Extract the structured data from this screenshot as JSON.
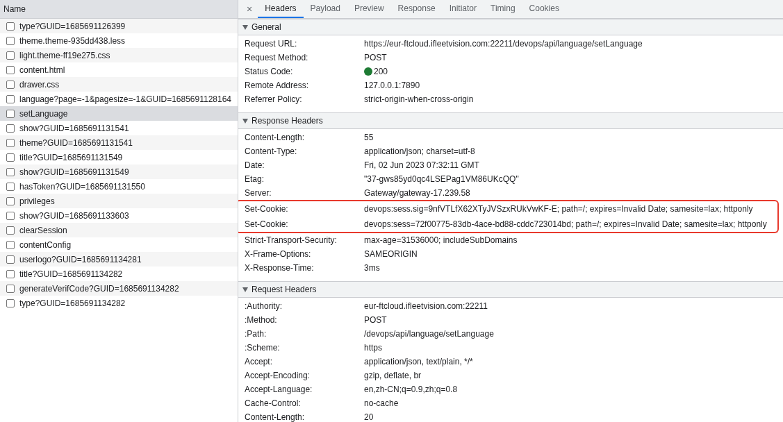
{
  "request_list": {
    "column": "Name",
    "rows": [
      {
        "name": "type?GUID=1685691126399",
        "selected": false
      },
      {
        "name": "theme.theme-935dd438.less",
        "selected": false
      },
      {
        "name": "light.theme-ff19e275.css",
        "selected": false
      },
      {
        "name": "content.html",
        "selected": false
      },
      {
        "name": "drawer.css",
        "selected": false
      },
      {
        "name": "language?page=-1&pagesize=-1&GUID=1685691128164",
        "selected": false
      },
      {
        "name": "setLanguage",
        "selected": true
      },
      {
        "name": "show?GUID=1685691131541",
        "selected": false
      },
      {
        "name": "theme?GUID=1685691131541",
        "selected": false
      },
      {
        "name": "title?GUID=1685691131549",
        "selected": false
      },
      {
        "name": "show?GUID=1685691131549",
        "selected": false
      },
      {
        "name": "hasToken?GUID=1685691131550",
        "selected": false
      },
      {
        "name": "privileges",
        "selected": false
      },
      {
        "name": "show?GUID=1685691133603",
        "selected": false
      },
      {
        "name": "clearSession",
        "selected": false
      },
      {
        "name": "contentConfig",
        "selected": false
      },
      {
        "name": "userlogo?GUID=1685691134281",
        "selected": false
      },
      {
        "name": "title?GUID=1685691134282",
        "selected": false
      },
      {
        "name": "generateVerifCode?GUID=1685691134282",
        "selected": false
      },
      {
        "name": "type?GUID=1685691134282",
        "selected": false
      }
    ]
  },
  "close_button": "×",
  "tabs": [
    {
      "label": "Headers",
      "selected": true
    },
    {
      "label": "Payload",
      "selected": false
    },
    {
      "label": "Preview",
      "selected": false
    },
    {
      "label": "Response",
      "selected": false
    },
    {
      "label": "Initiator",
      "selected": false
    },
    {
      "label": "Timing",
      "selected": false
    },
    {
      "label": "Cookies",
      "selected": false
    }
  ],
  "sections": [
    {
      "title": "General",
      "expanded": true,
      "rows": [
        {
          "key": "Request URL:",
          "value": "https://eur-ftcloud.ifleetvision.com:22211/devops/api/language/setLanguage"
        },
        {
          "key": "Request Method:",
          "value": "POST"
        },
        {
          "key": "Status Code:",
          "value": "200",
          "color": "#1e7b34"
        },
        {
          "key": "Remote Address:",
          "value": "127.0.0.1:7890"
        },
        {
          "key": "Referrer Policy:",
          "value": "strict-origin-when-cross-origin"
        }
      ]
    },
    {
      "title": "Response Headers",
      "expanded": true,
      "rows": [
        {
          "key": "Content-Length:",
          "value": "55"
        },
        {
          "key": "Content-Type:",
          "value": "application/json; charset=utf-8"
        },
        {
          "key": "Date:",
          "value": "Fri, 02 Jun 2023 07:32:11 GMT"
        },
        {
          "key": "Etag:",
          "value": "\"37-gws85yd0qc4LSEPag1VM86UKcQQ\""
        },
        {
          "key": "Server:",
          "value": "Gateway/gateway-17.239.58"
        },
        {
          "key": "Set-Cookie:",
          "value": "devops:sess.sig=9nfVTLfX62XTyJVSzxRUkVwKF-E; path=/; expires=Invalid Date; samesite=lax; httponly",
          "highlighted": true
        },
        {
          "key": "Set-Cookie:",
          "value": "devops:sess=72f00775-83db-4ace-bd88-cddc723014bd; path=/; expires=Invalid Date; samesite=lax; httponly",
          "highlighted": true
        },
        {
          "key": "Strict-Transport-Security:",
          "value": "max-age=31536000; includeSubDomains"
        },
        {
          "key": "X-Frame-Options:",
          "value": "SAMEORIGIN"
        },
        {
          "key": "X-Response-Time:",
          "value": "3ms"
        }
      ]
    },
    {
      "title": "Request Headers",
      "expanded": true,
      "rows": [
        {
          "key": ":Authority:",
          "value": "eur-ftcloud.ifleetvision.com:22211"
        },
        {
          "key": ":Method:",
          "value": "POST"
        },
        {
          "key": ":Path:",
          "value": "/devops/api/language/setLanguage"
        },
        {
          "key": ":Scheme:",
          "value": "https"
        },
        {
          "key": "Accept:",
          "value": "application/json, text/plain, */*"
        },
        {
          "key": "Accept-Encoding:",
          "value": "gzip, deflate, br"
        },
        {
          "key": "Accept-Language:",
          "value": "en,zh-CN;q=0.9,zh;q=0.8"
        },
        {
          "key": "Cache-Control:",
          "value": "no-cache"
        },
        {
          "key": "Content-Length:",
          "value": "20"
        }
      ]
    }
  ]
}
